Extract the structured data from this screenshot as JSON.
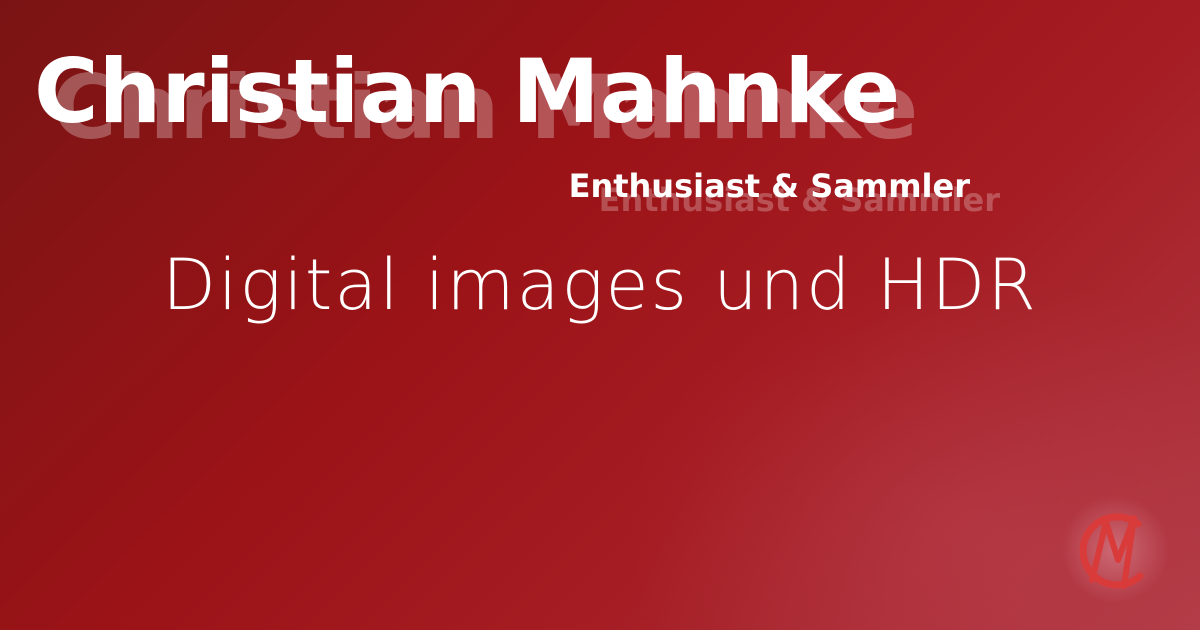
{
  "name": "Christian Mahnke",
  "tagline": "Enthusiast & Sammler",
  "headline": "Digital images und HDR",
  "logo": {
    "icon": "cm-monogram-icon",
    "color": "#d93a3a"
  },
  "colors": {
    "background_start": "#7a1414",
    "background_mid": "#9b1317",
    "background_end": "#b13a45",
    "text": "#ffffff"
  }
}
